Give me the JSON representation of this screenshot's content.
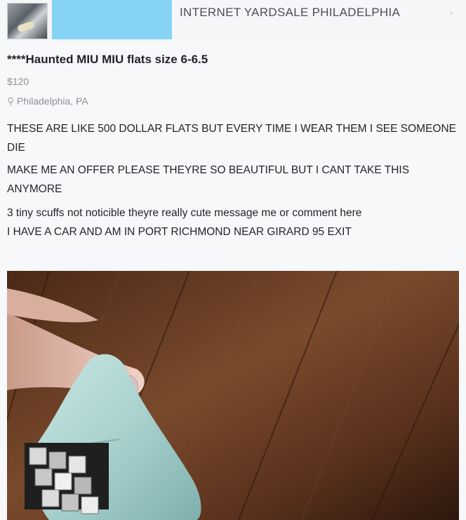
{
  "header": {
    "group_name": "INTERNET YARDSALE PHILADELPHIA",
    "thumbnail_icon": "group-photo-thumbnail",
    "chevron_icon": "chevron-down-icon"
  },
  "listing": {
    "title": "****Haunted MIU MIU flats size 6-6.5",
    "price": "$120",
    "location_icon": "location-pin-icon",
    "location": "Philadelphia, PA",
    "description": [
      "THESE ARE LIKE 500 DOLLAR FLATS BUT EVERY TIME I WEAR THEM I SEE SOMEONE DIE",
      "MAKE ME AN OFFER PLEASE THEYRE SO BEAUTIFUL BUT I CANT TAKE THIS ANYMORE",
      "3 tiny scuffs not noticible theyre really cute message me or comment here",
      "I HAVE A CAR AND AM IN PORT RICHMOND NEAR GIRARD 95 EXIT"
    ],
    "photo": "listing-photo"
  },
  "colors": {
    "cover_block": "#86d4f5",
    "wood_dark": "#3a2014",
    "wood_light": "#7a4a2c",
    "shoe": "#a9d2cf",
    "skin": "#e7c2b6"
  }
}
